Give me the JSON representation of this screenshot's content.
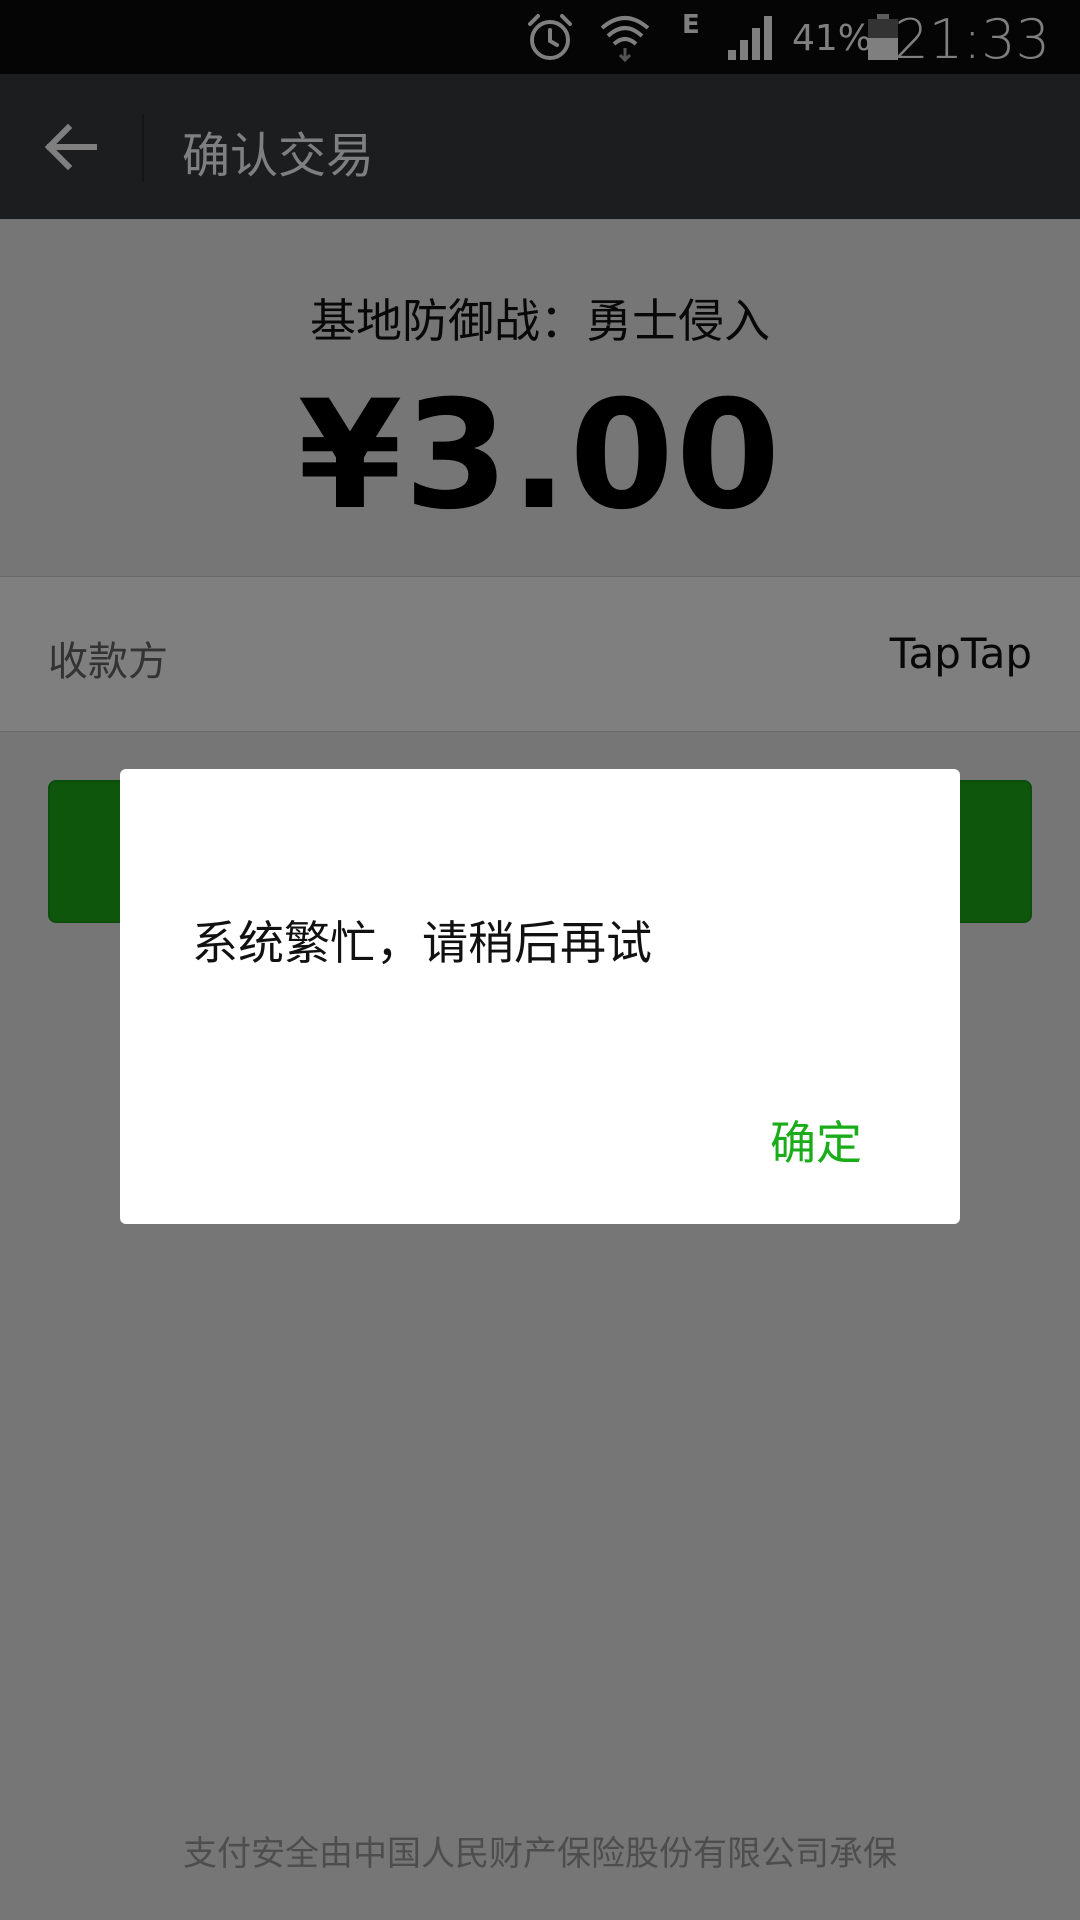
{
  "status_bar": {
    "network_type": "E",
    "battery_percent": "41%",
    "time": "21:33",
    "icons": [
      "alarm-icon",
      "wifi-icon",
      "signal-icon",
      "battery-icon"
    ]
  },
  "app_bar": {
    "title": "确认交易",
    "back_icon": "arrow-left-icon"
  },
  "order": {
    "product_name": "基地防御战：勇士侵入",
    "amount": "¥3.00"
  },
  "payee": {
    "label": "收款方",
    "value": "TapTap"
  },
  "pay_button": {
    "label": ""
  },
  "footer": {
    "text": "支付安全由中国人民财产保险股份有限公司承保"
  },
  "dialog": {
    "message": "系统繁忙，请稍后再试",
    "ok_label": "确定"
  },
  "colors": {
    "accent_green": "#1aad19",
    "app_bar": "#393a3f",
    "status_bar": "#0a0a0b"
  }
}
